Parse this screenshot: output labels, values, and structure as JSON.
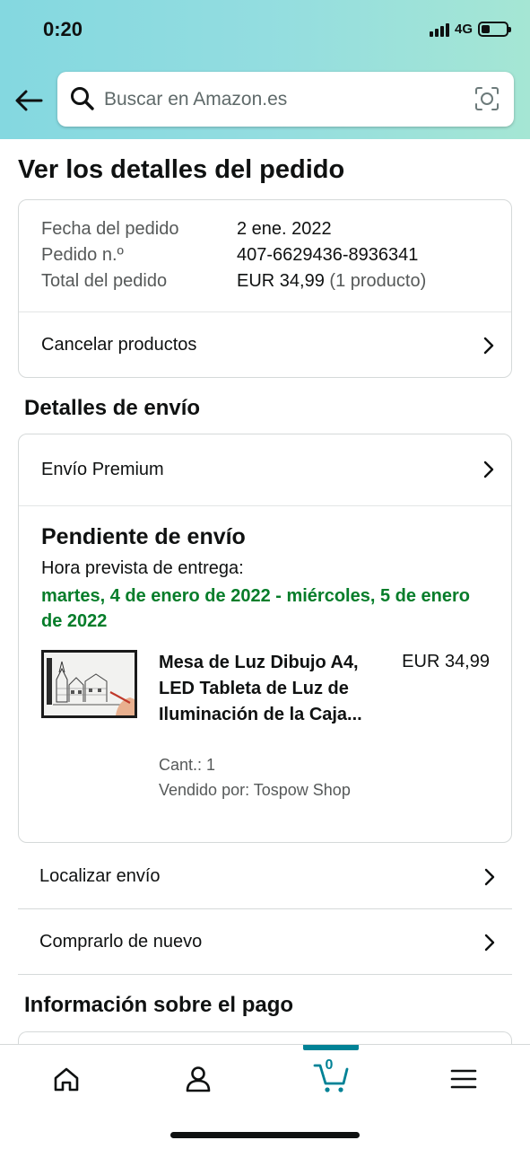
{
  "status_bar": {
    "time": "0:20",
    "network": "4G",
    "battery_level": 0.35
  },
  "header": {
    "search_placeholder": "Buscar en Amazon.es",
    "back_icon": "arrow-left-icon",
    "search_icon": "magnifier-icon",
    "camera_icon": "camera-scan-icon"
  },
  "page": {
    "title": "Ver los detalles del pedido"
  },
  "summary": {
    "rows": [
      {
        "label": "Fecha del pedido",
        "value": "2 ene. 2022"
      },
      {
        "label": "Pedido n.º",
        "value": "407-6629436-8936341"
      },
      {
        "label": "Total del pedido",
        "value": "EUR 34,99",
        "extra": "(1 producto)"
      }
    ],
    "cancel_label": "Cancelar productos"
  },
  "shipping": {
    "section_title": "Detalles de envío",
    "method": "Envío Premium",
    "status_title": "Pendiente de envío",
    "eta_label": "Hora prevista de entrega:",
    "eta_dates": "martes, 4 de enero de 2022 - miércoles, 5 de enero de 2022",
    "product": {
      "title": "Mesa de Luz Dibujo A4, LED Tableta de Luz de Iluminación de la Caja...",
      "price": "EUR 34,99",
      "qty": "Cant.: 1",
      "seller": "Vendido por: Tospow Shop"
    }
  },
  "actions": {
    "track": "Localizar envío",
    "buy_again": "Comprarlo de nuevo"
  },
  "payment": {
    "section_title": "Información sobre el pago"
  },
  "tabbar": {
    "items": [
      {
        "name": "home",
        "icon": "home-icon"
      },
      {
        "name": "account",
        "icon": "person-icon"
      },
      {
        "name": "cart",
        "icon": "cart-icon",
        "count": "0",
        "active": true
      },
      {
        "name": "menu",
        "icon": "hamburger-menu-icon"
      }
    ],
    "accent": "#008296"
  },
  "colors": {
    "header_gradient_start": "#84d8e0",
    "header_gradient_end": "#a5e6d4",
    "eta_green": "#067d2a"
  }
}
